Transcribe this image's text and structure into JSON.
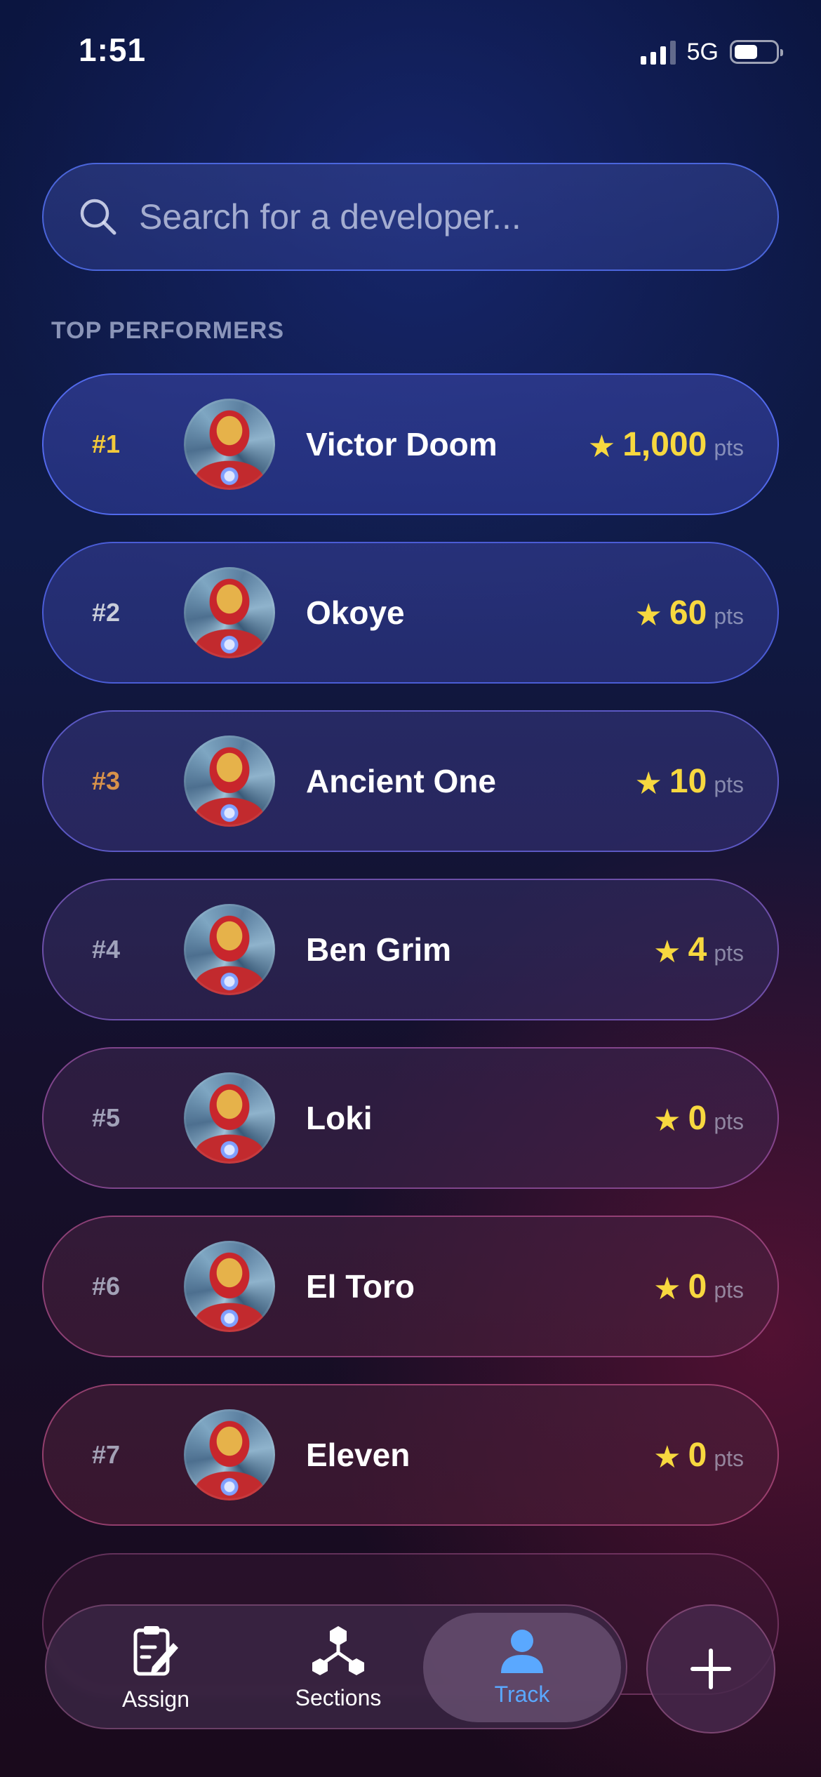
{
  "status_bar": {
    "time": "1:51",
    "network": "5G",
    "battery_level": 0.58
  },
  "search": {
    "placeholder": "Search for a developer...",
    "value": ""
  },
  "section_title": "TOP PERFORMERS",
  "performers": [
    {
      "rank": "#1",
      "name": "Victor Doom",
      "points": "1,000",
      "unit": "pts"
    },
    {
      "rank": "#2",
      "name": "Okoye",
      "points": "60",
      "unit": "pts"
    },
    {
      "rank": "#3",
      "name": "Ancient One",
      "points": "10",
      "unit": "pts"
    },
    {
      "rank": "#4",
      "name": "Ben Grim",
      "points": "4",
      "unit": "pts"
    },
    {
      "rank": "#5",
      "name": "Loki",
      "points": "0",
      "unit": "pts"
    },
    {
      "rank": "#6",
      "name": "El Toro",
      "points": "0",
      "unit": "pts"
    },
    {
      "rank": "#7",
      "name": "Eleven",
      "points": "0",
      "unit": "pts"
    }
  ],
  "tabs": [
    {
      "label": "Assign",
      "icon": "clipboard-edit-icon",
      "active": false
    },
    {
      "label": "Sections",
      "icon": "nodes-icon",
      "active": false
    },
    {
      "label": "Track",
      "icon": "person-icon",
      "active": true
    }
  ],
  "fab_icon": "plus-icon",
  "colors": {
    "accent_blue": "#5aa8ff",
    "star_yellow": "#f7d83f",
    "rank_gold": "#f2c93b",
    "rank_bronze": "#d8924a"
  }
}
